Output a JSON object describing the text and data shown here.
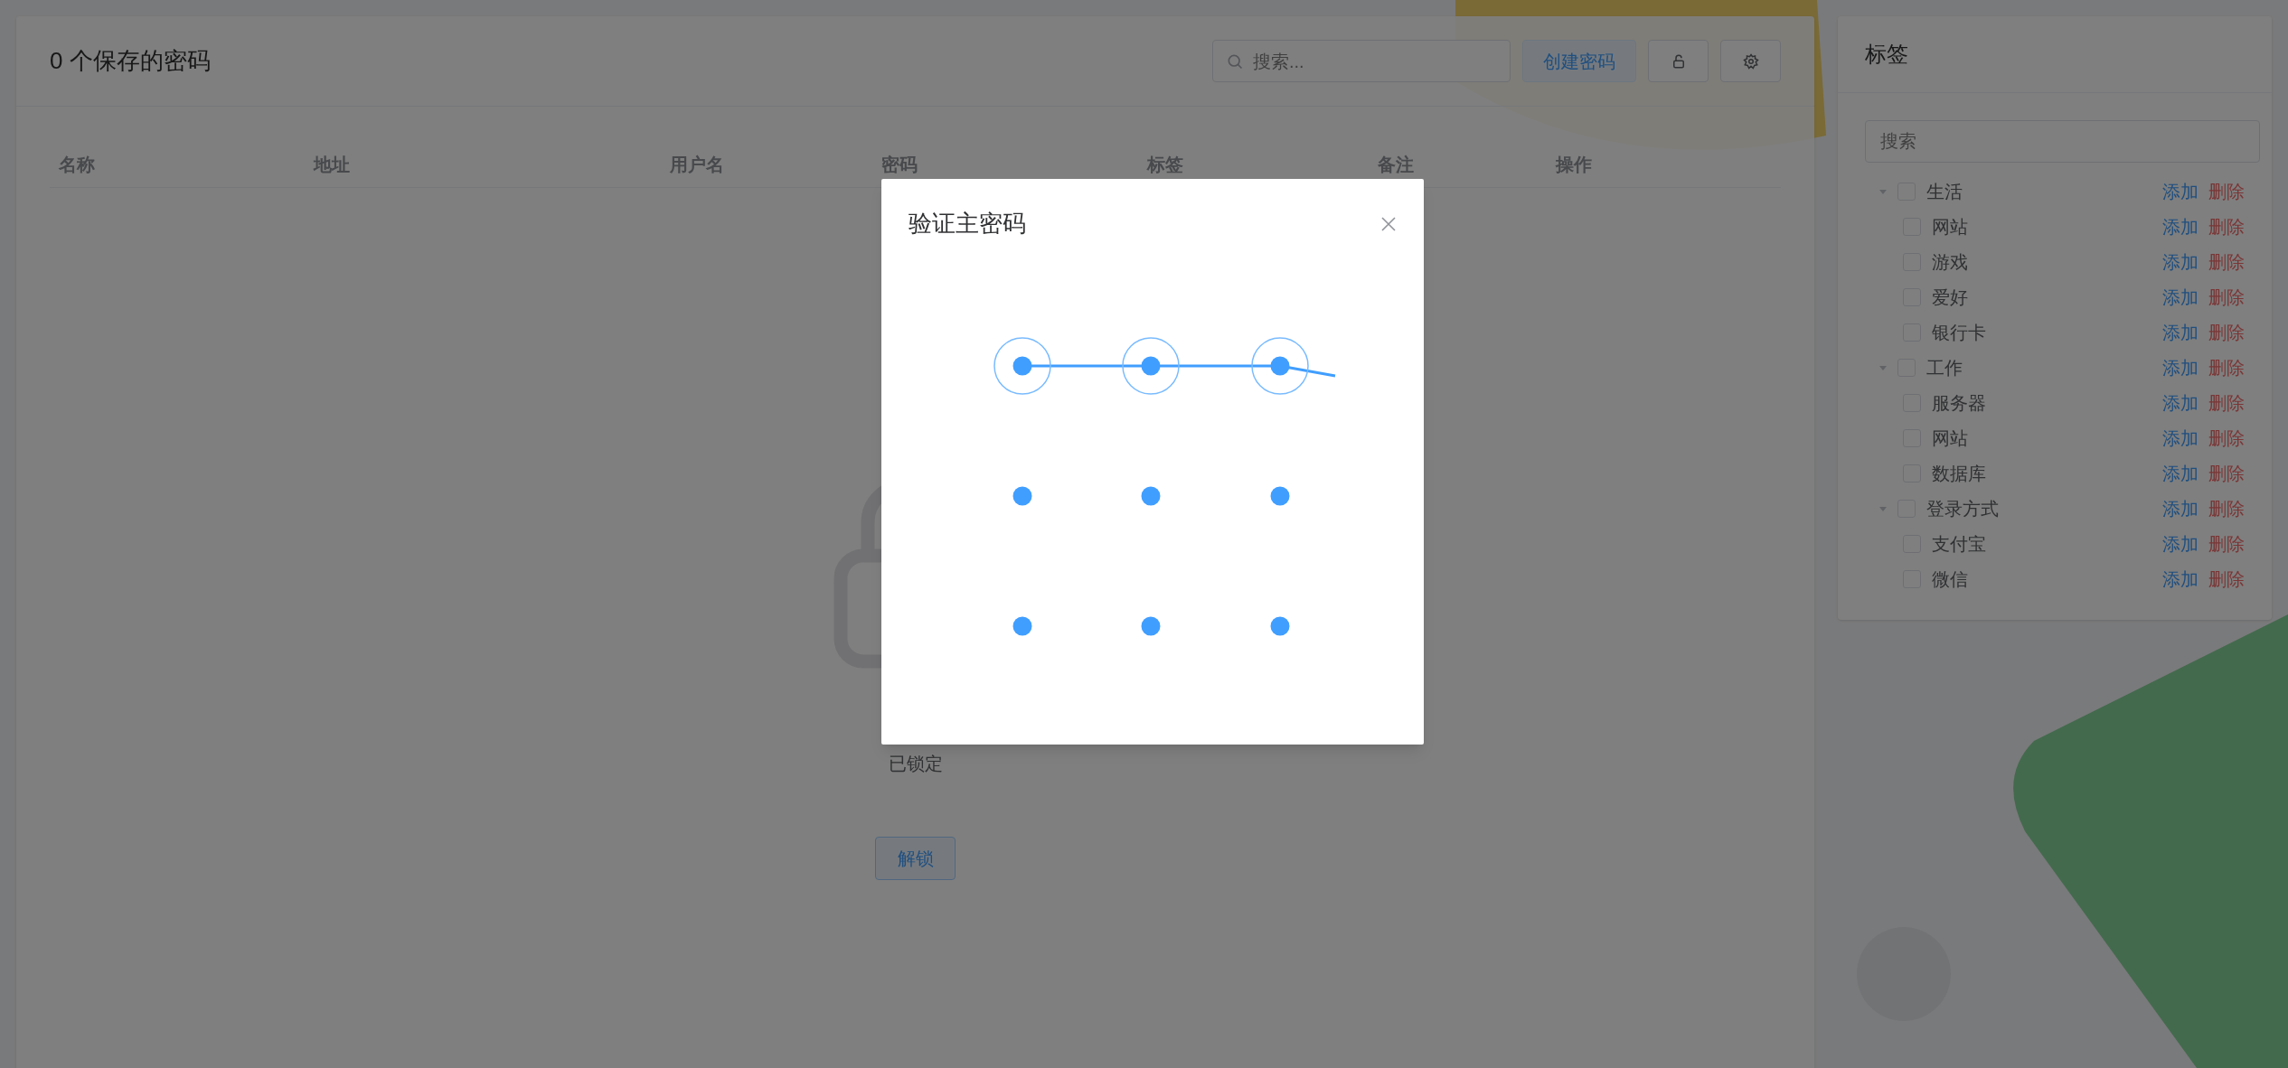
{
  "header": {
    "title": "0 个保存的密码",
    "search": {
      "placeholder": "搜索..."
    },
    "create_button": "创建密码"
  },
  "table": {
    "columns": [
      "名称",
      "地址",
      "用户名",
      "密码",
      "标签",
      "备注",
      "操作"
    ]
  },
  "locked_state": {
    "message": "已锁定",
    "unlock_button": "解锁"
  },
  "tags_panel": {
    "title": "标签",
    "search": {
      "placeholder": "搜索"
    },
    "items": [
      {
        "label": "生活",
        "expanded": true,
        "checked": false,
        "add": "添加",
        "delete": "删除",
        "children": [
          {
            "label": "网站",
            "checked": false,
            "add": "添加",
            "delete": "删除"
          },
          {
            "label": "游戏",
            "checked": false,
            "add": "添加",
            "delete": "删除"
          },
          {
            "label": "爱好",
            "checked": false,
            "add": "添加",
            "delete": "删除"
          },
          {
            "label": "银行卡",
            "checked": false,
            "add": "添加",
            "delete": "删除"
          }
        ]
      },
      {
        "label": "工作",
        "expanded": true,
        "checked": false,
        "add": "添加",
        "delete": "删除",
        "children": [
          {
            "label": "服务器",
            "checked": false,
            "add": "添加",
            "delete": "删除"
          },
          {
            "label": "网站",
            "checked": false,
            "add": "添加",
            "delete": "删除"
          },
          {
            "label": "数据库",
            "checked": false,
            "add": "添加",
            "delete": "删除"
          }
        ]
      },
      {
        "label": "登录方式",
        "expanded": true,
        "checked": false,
        "add": "添加",
        "delete": "删除",
        "children": [
          {
            "label": "支付宝",
            "checked": false,
            "add": "添加",
            "delete": "删除"
          },
          {
            "label": "微信",
            "checked": false,
            "add": "添加",
            "delete": "删除"
          }
        ]
      }
    ]
  },
  "dialog": {
    "title": "验证主密码",
    "pattern_lock": {
      "dots": [
        {
          "selected": true
        },
        {
          "selected": true
        },
        {
          "selected": true
        },
        {
          "selected": false
        },
        {
          "selected": false
        },
        {
          "selected": false
        },
        {
          "selected": false
        },
        {
          "selected": false
        },
        {
          "selected": false
        }
      ]
    }
  }
}
